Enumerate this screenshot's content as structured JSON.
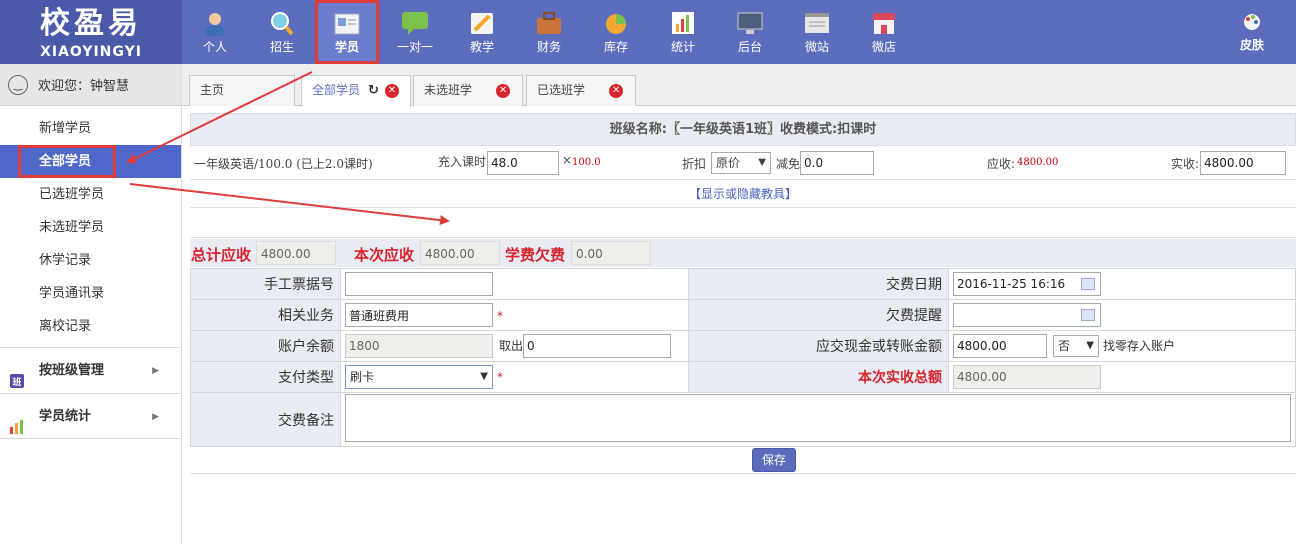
{
  "logo": {
    "cn": "校盈易",
    "en": "XIAOYINGYI"
  },
  "nav": [
    {
      "label": "个人",
      "icon": "person-icon",
      "color": "#f0c9a0"
    },
    {
      "label": "招生",
      "icon": "magnifier-icon",
      "color": "#7fd0e8"
    },
    {
      "label": "学员",
      "icon": "student-card-icon",
      "color": "#f3f3f3"
    },
    {
      "label": "一对一",
      "icon": "chat-bubble-icon",
      "color": "#7cc24a"
    },
    {
      "label": "教学",
      "icon": "pencil-note-icon",
      "color": "#f5d37a"
    },
    {
      "label": "财务",
      "icon": "briefcase-icon",
      "color": "#c9743a"
    },
    {
      "label": "库存",
      "icon": "pie-icon",
      "color": "#f1a930"
    },
    {
      "label": "统计",
      "icon": "bar-chart-icon",
      "color": "#f2a33a"
    },
    {
      "label": "后台",
      "icon": "monitor-icon",
      "color": "#4e5e7e"
    },
    {
      "label": "微站",
      "icon": "webpage-icon",
      "color": "#e6e6e6"
    },
    {
      "label": "微店",
      "icon": "shop-icon",
      "color": "#d9475a"
    }
  ],
  "skin": {
    "label": "皮肤",
    "icon": "palette-icon"
  },
  "sidebar": {
    "welcome": "欢迎您：钟智慧",
    "items": [
      {
        "label": "新增学员"
      },
      {
        "label": "全部学员"
      },
      {
        "label": "已选班学员"
      },
      {
        "label": "未选班学员"
      },
      {
        "label": "休学记录"
      },
      {
        "label": "学员通讯录"
      },
      {
        "label": "离校记录"
      }
    ],
    "groups": [
      {
        "label": "按班级管理",
        "icon": "class-icon"
      },
      {
        "label": "学员统计",
        "icon": "stats-icon"
      }
    ]
  },
  "tabs": [
    {
      "label": "主页"
    },
    {
      "label": "全部学员"
    },
    {
      "label": "未选班学"
    },
    {
      "label": "已选班学"
    }
  ],
  "class_title": "班级名称:〖一年级英语1班〗收费模式:扣课时",
  "course": {
    "name": "一年级英语/100.0 (已上2.0课时)",
    "charge_label": "充入课时",
    "charge_value": "48.0",
    "times": "×",
    "unit_price": "100.0",
    "discount_label": "折扣",
    "discount_value": "原价",
    "reduce_label": "减免",
    "reduce_value": "0.0",
    "receivable_label": "应收:",
    "receivable_value": "4800.00",
    "paid_label": "实收:",
    "paid_value": "4800.00"
  },
  "toggle_text": "【显示或隐藏教具】",
  "summary": {
    "total_label": "总计应收",
    "total_value": "4800.00",
    "current_label": "本次应收",
    "current_value": "4800.00",
    "arrears_label": "学费欠费",
    "arrears_value": "0.00"
  },
  "form": {
    "receipt_label": "手工票据号",
    "receipt_value": "",
    "pay_date_label": "交费日期",
    "pay_date_value": "2016-11-25 16:16",
    "business_label": "相关业务",
    "business_value": "普通班费用",
    "arrears_reminder_label": "欠费提醒",
    "arrears_reminder_value": "",
    "balance_label": "账户余额",
    "balance_value": "1800",
    "withdraw_label": "取出",
    "withdraw_value": "0",
    "cash_label": "应交现金或转账金额",
    "cash_value": "4800.00",
    "change_option": "否",
    "change_text": "找零存入账户",
    "pay_type_label": "支付类型",
    "pay_type_value": "刷卡",
    "total_paid_label": "本次实收总额",
    "total_paid_value": "4800.00",
    "note_label": "交费备注",
    "note_value": ""
  },
  "save_label": "保存",
  "colors": {
    "topbar": "#5d6dbe",
    "accent_red": "#d9232d",
    "highlight": "#e23b3b",
    "active_blue": "#4f67c9"
  }
}
